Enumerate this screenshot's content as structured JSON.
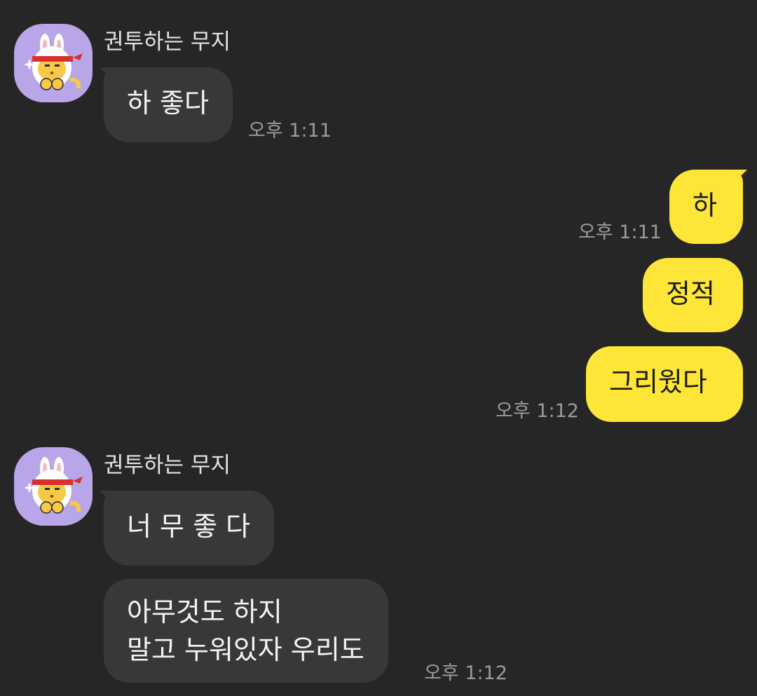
{
  "chat": {
    "groups": [
      {
        "sender": "권투하는 무지",
        "avatar_icon": "muzi-boxing-avatar-icon",
        "messages": [
          {
            "text": "하 좋다",
            "time": "오후 1:11"
          }
        ]
      },
      {
        "sender": "me",
        "messages": [
          {
            "text": "하",
            "time": "오후 1:11"
          },
          {
            "text": "정적",
            "time": ""
          },
          {
            "text": "그리웠다",
            "time": "오후 1:12"
          }
        ]
      },
      {
        "sender": "권투하는 무지",
        "avatar_icon": "muzi-boxing-avatar-icon",
        "messages": [
          {
            "text": "너 무 좋 다",
            "time": ""
          },
          {
            "text": "아무것도 하지\n말고 누워있자 우리도",
            "time": "오후 1:12"
          }
        ]
      }
    ]
  },
  "colors": {
    "background": "#262626",
    "incoming_bubble": "#383838",
    "outgoing_bubble": "#fde637",
    "avatar_bg": "#b9a6e8",
    "timestamp": "#9b9b9b"
  }
}
